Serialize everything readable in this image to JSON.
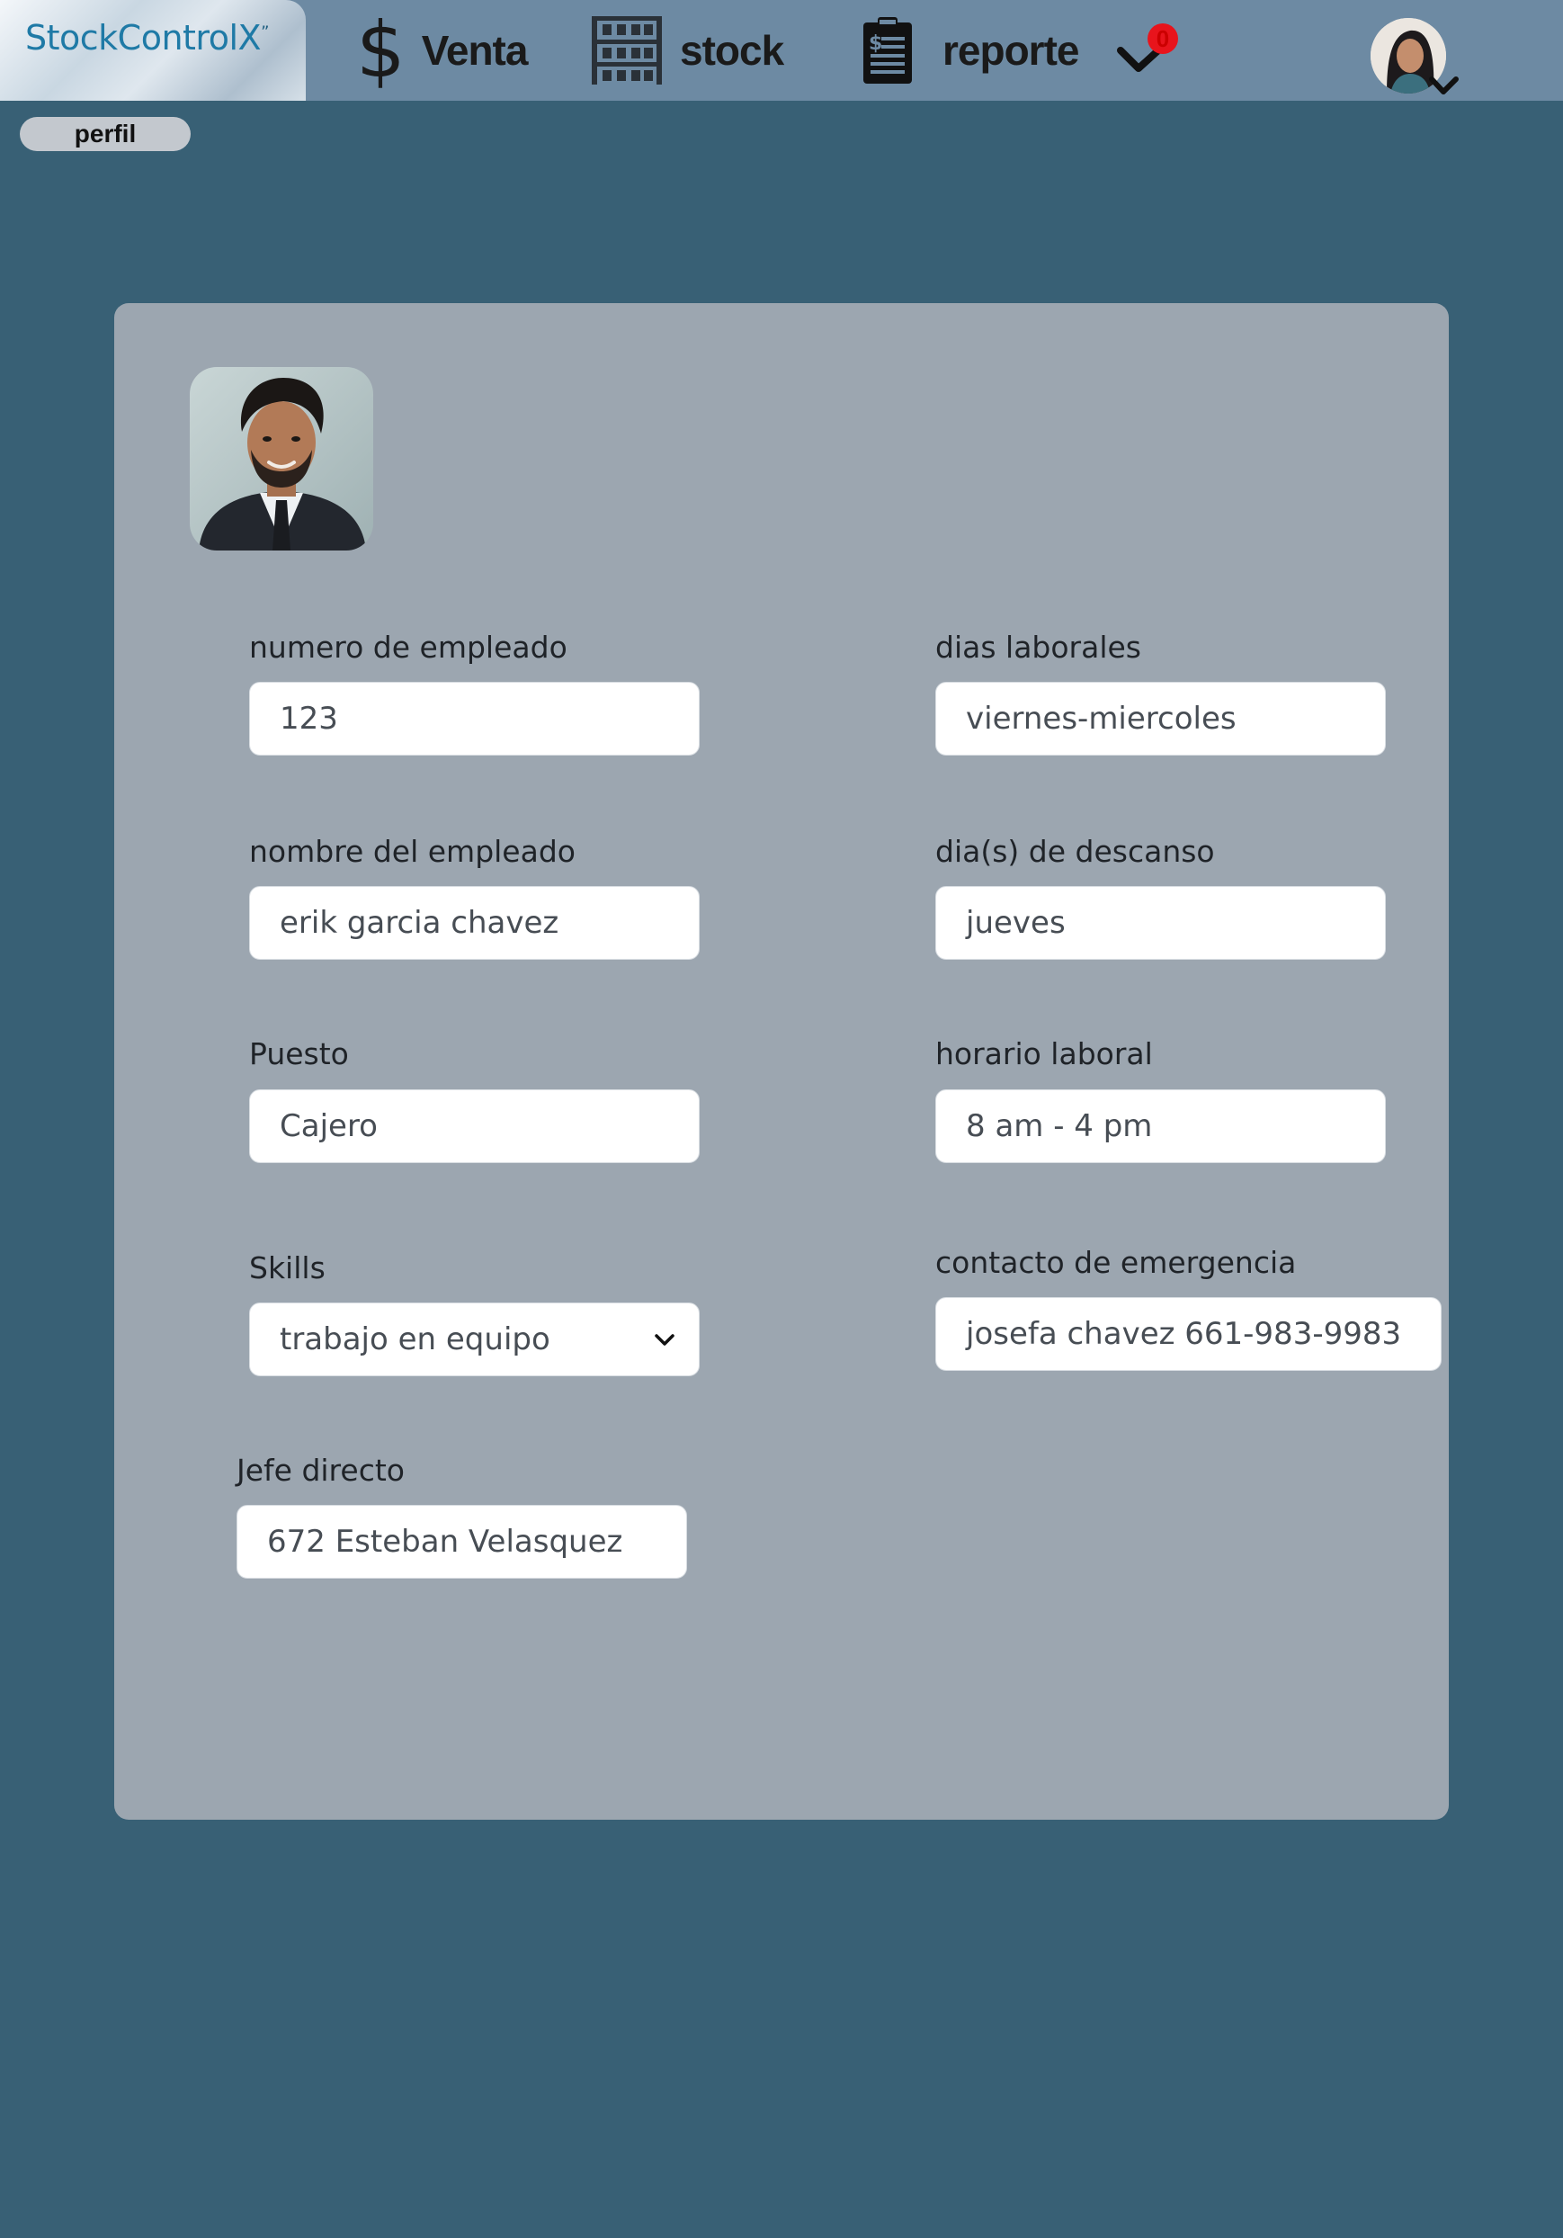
{
  "app": {
    "logo_name": "StockControlX",
    "logo_mark": "”"
  },
  "nav": {
    "items": [
      {
        "label": "Venta",
        "icon": "dollar-icon"
      },
      {
        "label": "stock",
        "icon": "shelves-icon"
      },
      {
        "label": "reporte",
        "icon": "report-clipboard-icon"
      }
    ],
    "notifications": {
      "icon": "chevron-down-icon",
      "count": "0"
    },
    "user": {
      "icon": "avatar",
      "menu_icon": "chevron-down-icon"
    }
  },
  "breadcrumb": {
    "label": "perfil"
  },
  "profile": {
    "photo": "employee-photo",
    "fields": {
      "numero_empleado": {
        "label": "numero de empleado",
        "value": "123"
      },
      "nombre": {
        "label": "nombre del empleado",
        "value": "erik garcia chavez"
      },
      "puesto": {
        "label": "Puesto",
        "value": "Cajero"
      },
      "skills": {
        "label": "Skills",
        "value": "trabajo en equipo"
      },
      "jefe": {
        "label": "Jefe directo",
        "value": "672 Esteban Velasquez"
      },
      "dias_laborales": {
        "label": "dias laborales",
        "value": "viernes-miercoles"
      },
      "descanso": {
        "label": "dia(s) de descanso",
        "value": "jueves"
      },
      "horario": {
        "label": "horario laboral",
        "value": "8 am - 4 pm"
      },
      "emergencia": {
        "label": "contacto de emergencia",
        "value": "josefa chavez 661-983-9983"
      }
    }
  },
  "colors": {
    "page_bg": "#386075",
    "topbar_bg": "#6d8aa3",
    "card_bg": "#9ca6b0",
    "badge": "#e8141c",
    "logo_text": "#1f7aa6"
  }
}
